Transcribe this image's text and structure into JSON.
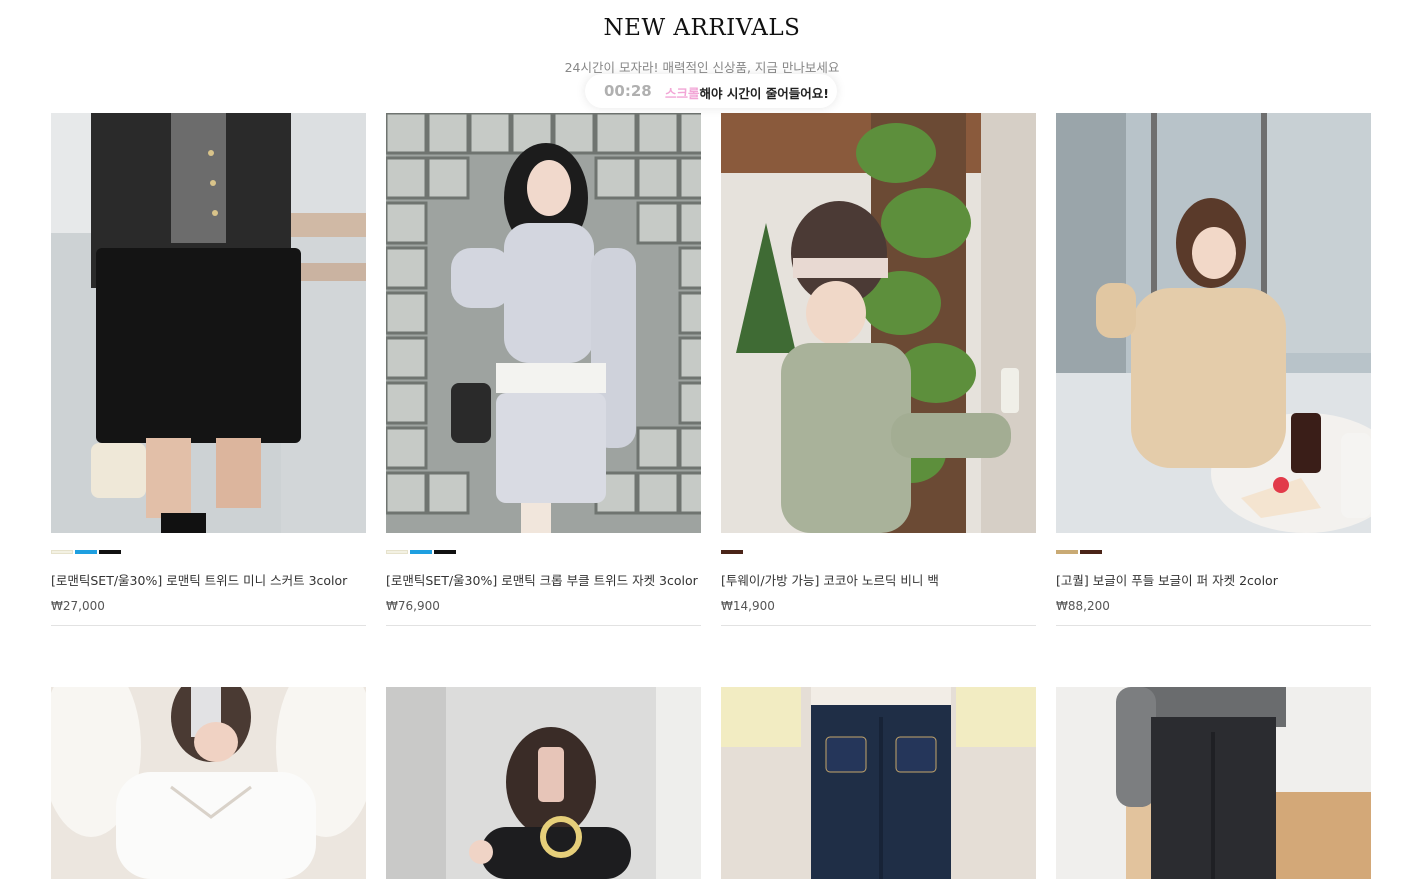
{
  "section": {
    "title": "NEW ARRIVALS",
    "subtitle": "24시간이 모자라! 매력적인 신상품, 지금 만나보세요",
    "timer": {
      "clock": "00:28",
      "highlight": "스크롤",
      "message": "해야 시간이 줄어들어요!"
    }
  },
  "products": [
    {
      "name": "[로맨틱SET/울30%] 로맨틱 트위드 미니 스커트 3color",
      "price": "₩27,000",
      "swatches": [
        "#f3f1e3",
        "#1e9fe0",
        "#111111"
      ]
    },
    {
      "name": "[로맨틱SET/울30%] 로맨틱 크롭 부클 트위드 자켓 3color",
      "price": "₩76,900",
      "swatches": [
        "#f3f1e3",
        "#1e9fe0",
        "#111111"
      ]
    },
    {
      "name": "[투웨이/가방 가능] 코코아 노르딕 비니 백",
      "price": "₩14,900",
      "swatches": [
        "#4a2418"
      ]
    },
    {
      "name": "[고퀄] 보글이 푸들 보글이 퍼 자켓 2color",
      "price": "₩88,200",
      "swatches": [
        "#c9aa74",
        "#4a2418"
      ]
    }
  ],
  "second_row_photos": [
    {
      "image": "white-blouse-photo"
    },
    {
      "image": "knit-cardigan-photo"
    },
    {
      "image": "dark-denim-photo"
    },
    {
      "image": "black-jeans-photo"
    }
  ]
}
